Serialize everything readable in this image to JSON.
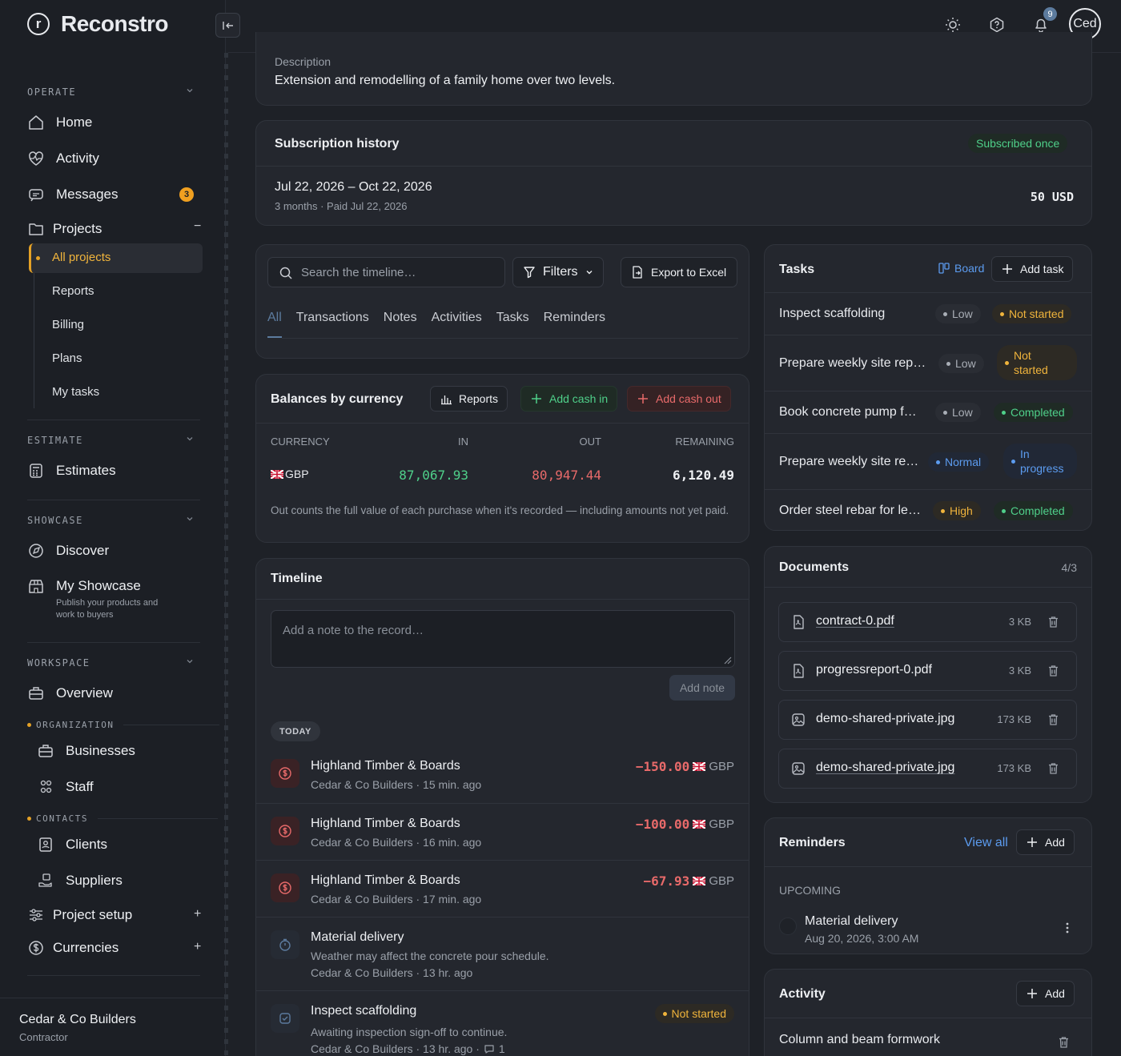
{
  "app": {
    "name": "Reconstro",
    "logo_letter": "r"
  },
  "sidebar": {
    "sections": {
      "operate": "OPERATE",
      "estimate": "ESTIMATE",
      "showcase": "SHOWCASE",
      "workspace": "WORKSPACE"
    },
    "nav": {
      "home": "Home",
      "activity": "Activity",
      "messages": "Messages",
      "messages_badge": "3",
      "projects": "Projects",
      "projects_toggle": "−",
      "estimates": "Estimates",
      "discover": "Discover",
      "my_showcase": "My Showcase",
      "my_showcase_desc": "Publish your products and work to buyers",
      "overview": "Overview",
      "businesses": "Businesses",
      "staff": "Staff",
      "clients": "Clients",
      "suppliers": "Suppliers",
      "project_setup": "Project setup",
      "currencies": "Currencies",
      "plus": "+"
    },
    "projects_sub": [
      "All projects",
      "Reports",
      "Billing",
      "Plans",
      "My tasks"
    ],
    "groups": {
      "organization": "ORGANIZATION",
      "contacts": "CONTACTS"
    },
    "org": {
      "name": "Cedar & Co Builders",
      "role": "Contractor"
    }
  },
  "topbar": {
    "notif_count": "9",
    "avatar_initials": "Ced"
  },
  "description": {
    "label": "Description",
    "text": "Extension and remodelling of a family home over two levels."
  },
  "subscription": {
    "title": "Subscription history",
    "badge": "Subscribed once",
    "period": "Jul 22, 2026 – Oct 22, 2026",
    "detail": "3 months · Paid Jul 22, 2026",
    "amount": "50 USD"
  },
  "timeline_filter": {
    "search_placeholder": "Search the timeline…",
    "filters": "Filters",
    "export": "Export to Excel",
    "tabs": [
      "All",
      "Transactions",
      "Notes",
      "Activities",
      "Tasks",
      "Reminders"
    ],
    "active_tab": "All"
  },
  "balances": {
    "title": "Balances by currency",
    "reports": "Reports",
    "add_in": "Add cash in",
    "add_out": "Add cash out",
    "columns": [
      "CURRENCY",
      "IN",
      "OUT",
      "REMAINING"
    ],
    "rows": [
      {
        "currency": "GBP",
        "in": "87,067.93",
        "out": "80,947.44",
        "remaining": "6,120.49"
      }
    ],
    "note": "Out counts the full value of each purchase when it's recorded — including amounts not yet paid."
  },
  "timeline": {
    "title": "Timeline",
    "note_placeholder": "Add a note to the record…",
    "add_note": "Add note",
    "day": "TODAY",
    "items": [
      {
        "title": "Highland Timber & Boards",
        "sub": "Cedar & Co Builders · 15 min. ago",
        "amount": "−150.00",
        "currency": "GBP"
      },
      {
        "title": "Highland Timber & Boards",
        "sub": "Cedar & Co Builders · 16 min. ago",
        "amount": "−100.00",
        "currency": "GBP"
      },
      {
        "title": "Highland Timber & Boards",
        "sub": "Cedar & Co Builders · 17 min. ago",
        "amount": "−67.93",
        "currency": "GBP"
      },
      {
        "title": "Material delivery",
        "desc": "Weather may affect the concrete pour schedule.",
        "sub": "Cedar & Co Builders · 13 hr. ago"
      },
      {
        "title": "Inspect scaffolding",
        "desc": "Awaiting inspection sign-off to continue.",
        "sub": "Cedar & Co Builders · 13 hr. ago ·",
        "comments": "1",
        "status": "Not started"
      }
    ]
  },
  "tasks": {
    "title": "Tasks",
    "board": "Board",
    "add": "Add task",
    "items": [
      {
        "name": "Inspect scaffolding",
        "priority": "Low",
        "status": "Not started"
      },
      {
        "name": "Prepare weekly site rep…",
        "priority": "Low",
        "status": "Not started"
      },
      {
        "name": "Book concrete pump f…",
        "priority": "Low",
        "status": "Completed"
      },
      {
        "name": "Prepare weekly site re…",
        "priority": "Normal",
        "status": "In progress"
      },
      {
        "name": "Order steel rebar for le…",
        "priority": "High",
        "status": "Completed"
      }
    ]
  },
  "documents": {
    "title": "Documents",
    "count": "4/3",
    "items": [
      {
        "name": "contract-0.pdf",
        "size": "3 KB",
        "icon": "pdf-file-icon"
      },
      {
        "name": "progressreport-0.pdf",
        "size": "3 KB",
        "icon": "pdf-file-icon"
      },
      {
        "name": "demo-shared-private.jpg",
        "size": "173 KB",
        "icon": "image-file-icon"
      },
      {
        "name": "demo-shared-private.jpg",
        "size": "173 KB",
        "icon": "image-file-icon"
      }
    ]
  },
  "reminders": {
    "title": "Reminders",
    "view_all": "View all",
    "add": "Add",
    "upcoming": "UPCOMING",
    "items": [
      {
        "title": "Material delivery",
        "date": "Aug 20, 2026, 3:00 AM"
      }
    ]
  },
  "activity": {
    "title": "Activity",
    "add": "Add",
    "items": [
      {
        "title": "Column and beam formwork"
      }
    ]
  },
  "colors": {
    "accent": "#e4a126",
    "positive": "#4fd08a",
    "negative": "#e86a6a",
    "link": "#5c9cf0",
    "background": "#1e2127",
    "card": "#24272e"
  }
}
